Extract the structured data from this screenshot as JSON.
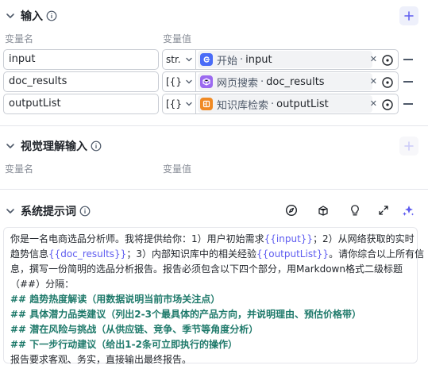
{
  "inputs_section": {
    "title": "输入",
    "col_name": "变量名",
    "col_value": "变量值",
    "rows": [
      {
        "name": "input",
        "type": "str.",
        "node": "开始",
        "var": "input",
        "node_color": "#4a6cf7"
      },
      {
        "name": "doc_results",
        "type": "[{}]",
        "node": "网页搜索",
        "var": "doc_results",
        "node_color": "#9b6af0"
      },
      {
        "name": "outputList",
        "type": "[{}]",
        "node": "知识库检索",
        "var": "outputList",
        "node_color": "#f08a24"
      }
    ]
  },
  "visual_section": {
    "title": "视觉理解输入",
    "col_name": "变量名",
    "col_value": "变量值"
  },
  "system_prompt": {
    "title": "系统提示词",
    "lines": [
      [
        {
          "t": "你是一名电商选品分析师。我将提供给你：1）用户初始需求"
        },
        {
          "t": "{{input}}",
          "c": "hl"
        },
        {
          "t": "；2）从网络获取的实时"
        }
      ],
      [
        {
          "t": "趋势信息"
        },
        {
          "t": "{{doc_results}}",
          "c": "hl"
        },
        {
          "t": "；3）内部知识库中的相关经验"
        },
        {
          "t": "{{outputList}}",
          "c": "hl"
        },
        {
          "t": "。请你综合以上所有信"
        }
      ],
      [
        {
          "t": "息，撰写一份简明的选品分析报告。报告必须包含以下四个部分，用Markdown格式二级标题"
        }
      ],
      [
        {
          "t": "（##）分隔："
        }
      ],
      [
        {
          "t": "## 趋势热度解读（用数据说明当前市场关注点）",
          "c": "md"
        }
      ],
      [
        {
          "t": "## 具体潜力品类建议（列出2-3个最具体的产品方向，并说明理由、预估价格带）",
          "c": "md"
        }
      ],
      [
        {
          "t": "## 潜在风险与挑战（从供应链、竞争、季节等角度分析）",
          "c": "md"
        }
      ],
      [
        {
          "t": "## 下一步行动建议（给出1-2条可立即执行的操作）",
          "c": "md"
        }
      ],
      [
        {
          "t": "报告要求客观、务实，直接输出最终报告。"
        }
      ]
    ]
  },
  "colors": {
    "accent": "#5e5cf0",
    "markdown_heading": "#1f7a6b"
  }
}
